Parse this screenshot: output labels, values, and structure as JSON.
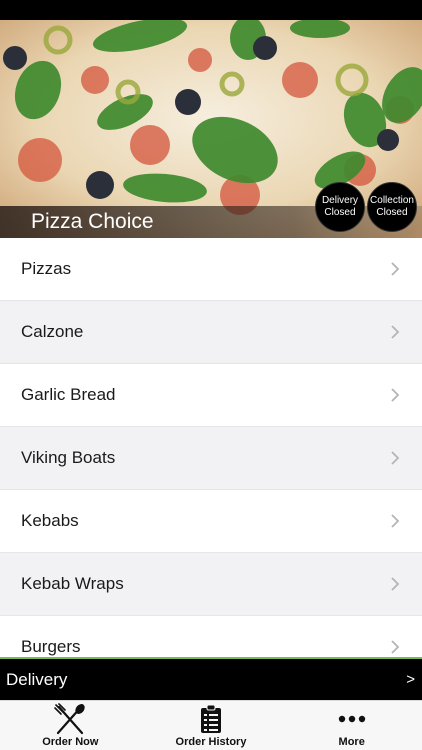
{
  "header": {
    "restaurant_name": "Pizza Choice",
    "delivery_status": {
      "line1": "Delivery",
      "line2": "Closed"
    },
    "collection_status": {
      "line1": "Collection",
      "line2": "Closed"
    }
  },
  "menu": {
    "categories": [
      {
        "label": "Pizzas"
      },
      {
        "label": "Calzone"
      },
      {
        "label": "Garlic Bread"
      },
      {
        "label": "Viking Boats"
      },
      {
        "label": "Kebabs"
      },
      {
        "label": "Kebab Wraps"
      },
      {
        "label": "Burgers"
      }
    ]
  },
  "order_mode": {
    "label": "Delivery",
    "arrow": ">"
  },
  "tabs": [
    {
      "label": "Order Now",
      "icon": "utensils-icon"
    },
    {
      "label": "Order History",
      "icon": "clipboard-list-icon"
    },
    {
      "label": "More",
      "icon": "more-dots-icon"
    }
  ],
  "colors": {
    "accent_green": "#7ab85a",
    "bar_black": "#000000",
    "row_alt": "#f2f2f5"
  }
}
